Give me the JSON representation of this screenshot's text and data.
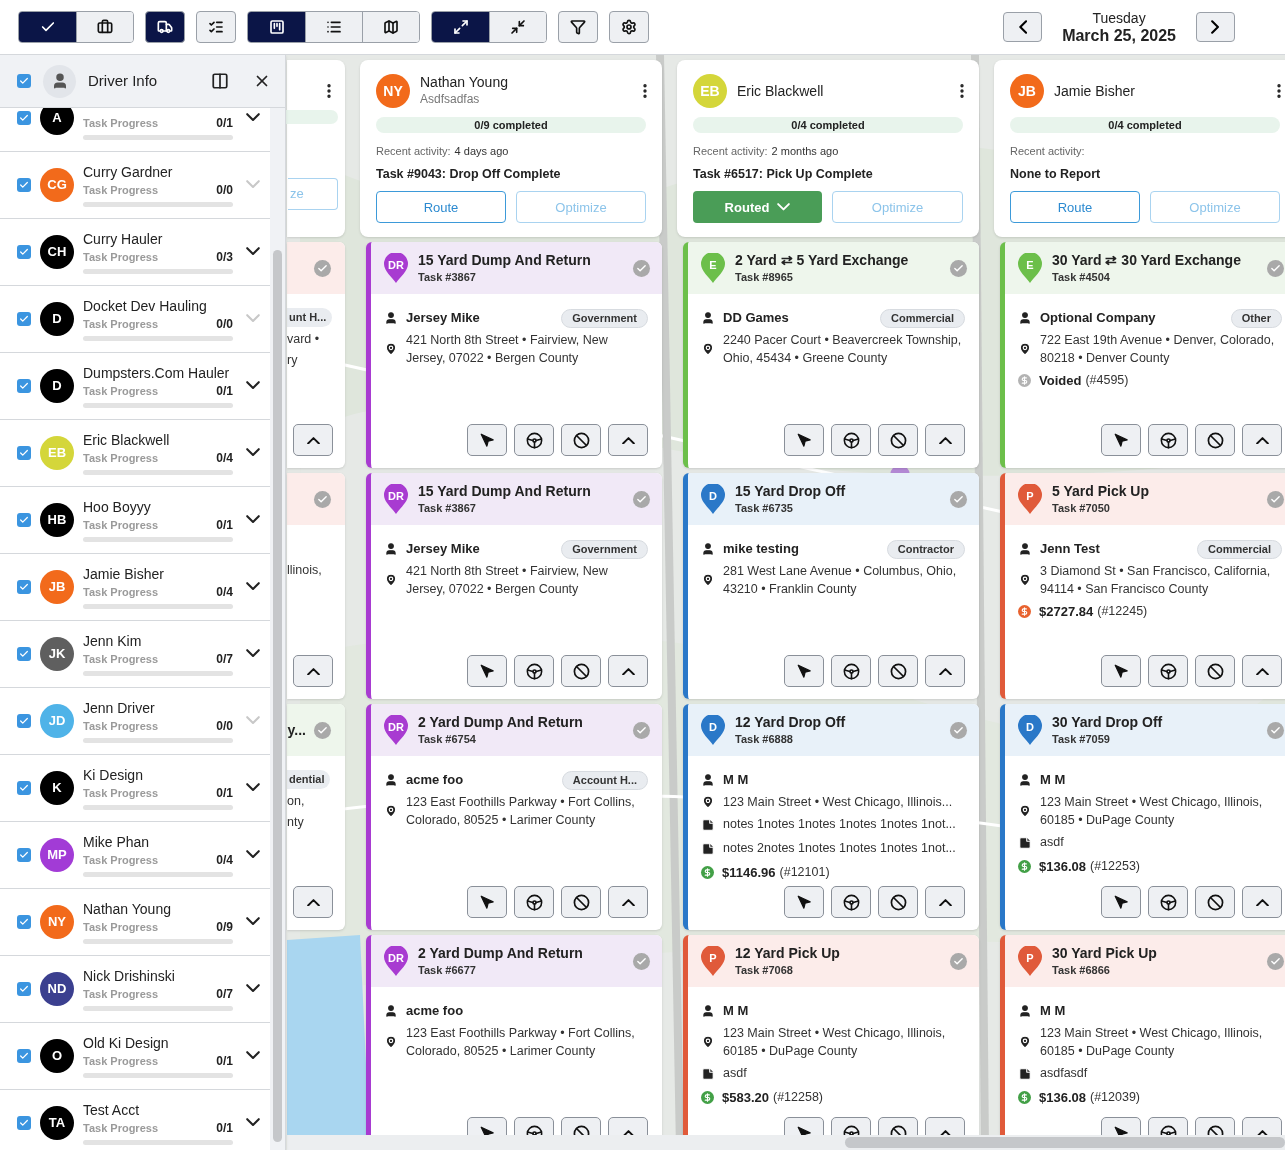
{
  "toolbar": {
    "groups": [
      {
        "buttons": [
          {
            "kind": "check",
            "selected": true
          },
          {
            "kind": "briefcase",
            "selected": false
          }
        ]
      },
      {
        "buttons": [
          {
            "kind": "truck",
            "selected": true
          }
        ]
      },
      {
        "buttons": [
          {
            "kind": "checklist",
            "selected": false
          }
        ]
      },
      {
        "buttons": [
          {
            "kind": "board",
            "selected": true
          },
          {
            "kind": "list",
            "selected": false
          },
          {
            "kind": "map",
            "selected": false
          }
        ]
      },
      {
        "buttons": [
          {
            "kind": "expand",
            "selected": true
          },
          {
            "kind": "collapse",
            "selected": false
          }
        ]
      },
      {
        "buttons": [
          {
            "kind": "filter",
            "selected": false
          }
        ]
      },
      {
        "buttons": [
          {
            "kind": "settings",
            "selected": false
          }
        ]
      }
    ]
  },
  "date_nav": {
    "weekday": "Tuesday",
    "date": "March 25, 2025"
  },
  "sidebar": {
    "title": "Driver Info",
    "checked": true,
    "drivers": [
      {
        "initials": "A",
        "color": "#000000",
        "checked": true,
        "label": "Task Progress",
        "count": "0/1",
        "level": 0,
        "disabled": false
      },
      {
        "initials": "CG",
        "name": "Curry Gardner",
        "color": "#f26a1b",
        "checked": true,
        "label": "Task Progress",
        "count": "0/0",
        "level": 0,
        "disabled": true
      },
      {
        "initials": "CH",
        "name": "Curry Hauler",
        "color": "#000000",
        "checked": true,
        "label": "Task Progress",
        "count": "0/3",
        "level": 0,
        "disabled": false
      },
      {
        "initials": "D",
        "name": "Docket Dev Hauling",
        "color": "#000000",
        "checked": true,
        "label": "Task Progress",
        "count": "0/0",
        "level": 0,
        "disabled": true
      },
      {
        "initials": "D",
        "name": "Dumpsters.Com Hauler",
        "color": "#000000",
        "checked": true,
        "label": "Task Progress",
        "count": "0/1",
        "level": 0,
        "disabled": false
      },
      {
        "initials": "EB",
        "name": "Eric Blackwell",
        "color": "#d4d63a",
        "checked": true,
        "label": "Task Progress",
        "count": "0/4",
        "level": 0,
        "disabled": false
      },
      {
        "initials": "HB",
        "name": "Hoo Boyyy",
        "color": "#000000",
        "checked": true,
        "label": "Task Progress",
        "count": "0/1",
        "level": 0,
        "disabled": false
      },
      {
        "initials": "JB",
        "name": "Jamie Bisher",
        "color": "#f26a1b",
        "checked": true,
        "label": "Task Progress",
        "count": "0/4",
        "level": 0,
        "disabled": false
      },
      {
        "initials": "JK",
        "name": "Jenn Kim",
        "color": "#5f5f5f",
        "checked": true,
        "label": "Task Progress",
        "count": "0/7",
        "level": 0,
        "disabled": false
      },
      {
        "initials": "JD",
        "name": "Jenn Driver",
        "color": "#4fb3e8",
        "checked": true,
        "label": "Task Progress",
        "count": "0/0",
        "level": 0,
        "disabled": true
      },
      {
        "initials": "K",
        "name": "Ki Design",
        "color": "#000000",
        "checked": true,
        "label": "Task Progress",
        "count": "0/1",
        "level": 0,
        "disabled": false
      },
      {
        "initials": "MP",
        "name": "Mike Phan",
        "color": "#a23bd6",
        "checked": true,
        "label": "Task Progress",
        "count": "0/4",
        "level": 0,
        "disabled": false
      },
      {
        "initials": "NY",
        "name": "Nathan Young",
        "color": "#f26a1b",
        "checked": true,
        "label": "Task Progress",
        "count": "0/9",
        "level": 0,
        "disabled": false
      },
      {
        "initials": "ND",
        "name": "Nick Drishinski",
        "color": "#3b3f8f",
        "checked": true,
        "label": "Task Progress",
        "count": "0/7",
        "level": 0,
        "disabled": false
      },
      {
        "initials": "O",
        "name": "Old Ki Design",
        "color": "#000000",
        "checked": true,
        "label": "Task Progress",
        "count": "0/1",
        "level": 0,
        "disabled": false
      },
      {
        "initials": "TA",
        "name": "Test Acct",
        "color": "#000000",
        "checked": true,
        "label": "Task Progress",
        "count": "0/1",
        "level": 0,
        "disabled": false
      }
    ]
  },
  "board": {
    "partial_column": {
      "optimize_fragment": "ze",
      "tasks": [
        {
          "kind": "pick_up",
          "chip": "unt H...",
          "lines": [
            "vard •",
            "ry"
          ]
        },
        {
          "kind": "pick_up",
          "lines": [
            "llinois,"
          ]
        },
        {
          "kind": "exchange",
          "title": "y...",
          "chip": "dential",
          "lines": [
            "on,",
            "nty"
          ]
        }
      ]
    },
    "columns": [
      {
        "driver": {
          "initials": "NY",
          "name": "Nathan Young",
          "subtitle": "Asdfsadfas",
          "color": "#f26a1b"
        },
        "completed": "0/9 completed",
        "level": 0,
        "activity_label": "Recent activity:",
        "activity_time": "4 days ago",
        "last_task": "Task #9043: Drop Off Complete",
        "route_button": {
          "label": "Route",
          "kind": "route"
        },
        "optimize_button": {
          "label": "Optimize",
          "disabled": true
        },
        "tasks": [
          {
            "kind": "dump_return",
            "marker": "DR",
            "title": "15 Yard Dump And Return",
            "number": "Task #3867",
            "customer": "Jersey Mike",
            "chip": "Government",
            "address": "421 North 8th Street • Fairview, New Jersey, 07022 • Bergen County"
          },
          {
            "kind": "dump_return",
            "marker": "DR",
            "title": "15 Yard Dump And Return",
            "number": "Task #3867",
            "customer": "Jersey Mike",
            "chip": "Government",
            "address": "421 North 8th Street • Fairview, New Jersey, 07022 • Bergen County"
          },
          {
            "kind": "dump_return",
            "marker": "DR",
            "title": "2 Yard Dump And Return",
            "number": "Task #6754",
            "customer": "acme foo",
            "chip": "Account H...",
            "address": "123 East Foothills Parkway • Fort Collins, Colorado, 80525 • Larimer County"
          },
          {
            "kind": "dump_return",
            "marker": "DR",
            "title": "2 Yard Dump And Return",
            "number": "Task #6677",
            "customer": "acme foo",
            "address": "123 East Foothills Parkway • Fort Collins, Colorado, 80525 • Larimer County"
          }
        ]
      },
      {
        "driver": {
          "initials": "EB",
          "name": "Eric Blackwell",
          "color": "#d4d63a"
        },
        "completed": "0/4 completed",
        "level": 0,
        "activity_label": "Recent activity:",
        "activity_time": "2 months ago",
        "last_task": "Task #6517: Pick Up Complete",
        "route_button": {
          "label": "Routed",
          "kind": "routed"
        },
        "optimize_button": {
          "label": "Optimize",
          "disabled": true
        },
        "tasks": [
          {
            "kind": "exchange",
            "marker": "E",
            "title": "2 Yard ⇄ 5 Yard Exchange",
            "number": "Task #8965",
            "customer": "DD Games",
            "chip": "Commercial",
            "address": "2240 Pacer Court • Beavercreek Township, Ohio, 45434 • Greene County"
          },
          {
            "kind": "drop_off",
            "marker": "D",
            "title": "15 Yard Drop Off",
            "number": "Task #6735",
            "customer": "mike testing",
            "chip": "Contractor",
            "address": "281 West Lane Avenue • Columbus, Ohio, 43210 • Franklin County"
          },
          {
            "kind": "drop_off",
            "marker": "D",
            "title": "12 Yard Drop Off",
            "number": "Task #6888",
            "customer": "M M",
            "address": "123 Main Street • West Chicago, Illinois...",
            "notes": [
              "notes 1notes 1notes 1notes 1notes 1not...",
              "notes 2notes 1notes 1notes 1notes 1not..."
            ],
            "payment": {
              "color": "#43a047",
              "amount": "$1146.96",
              "ref": "(#12101)"
            }
          },
          {
            "kind": "pick_up",
            "marker": "P",
            "title": "12 Yard Pick Up",
            "number": "Task #7068",
            "customer": "M M",
            "address": "123 Main Street • West Chicago, Illinois, 60185 • DuPage County",
            "notes": [
              "asdf"
            ],
            "payment": {
              "color": "#43a047",
              "amount": "$583.20",
              "ref": "(#12258)"
            }
          }
        ]
      },
      {
        "driver": {
          "initials": "JB",
          "name": "Jamie Bisher",
          "color": "#f26a1b"
        },
        "completed": "0/4 completed",
        "level": 0,
        "activity_label": "Recent activity:",
        "last_task": "None to Report",
        "route_button": {
          "label": "Route",
          "kind": "route"
        },
        "optimize_button": {
          "label": "Optimize",
          "disabled": true
        },
        "tasks": [
          {
            "kind": "exchange",
            "marker": "E",
            "title": "30 Yard ⇄ 30 Yard Exchange",
            "number": "Task #4504",
            "customer": "Optional Company",
            "chip": "Other",
            "address": "722 East 19th Avenue • Denver, Colorado, 80218 • Denver County",
            "payment": {
              "color": "#b3b3b3",
              "amount": "Voided",
              "ref": "(#4595)"
            }
          },
          {
            "kind": "pick_up",
            "marker": "P",
            "title": "5 Yard Pick Up",
            "number": "Task #7050",
            "customer": "Jenn Test",
            "chip": "Commercial",
            "address": "3 Diamond St • San Francisco, California, 94114 • San Francisco County",
            "payment": {
              "color": "#e8622e",
              "amount": "$2727.84",
              "ref": "(#12245)"
            }
          },
          {
            "kind": "drop_off",
            "marker": "D",
            "title": "30 Yard Drop Off",
            "number": "Task #7059",
            "customer": "M M",
            "address": "123 Main Street • West Chicago, Illinois, 60185 • DuPage County",
            "notes": [
              "asdf"
            ],
            "payment": {
              "color": "#43a047",
              "amount": "$136.08",
              "ref": "(#12253)"
            }
          },
          {
            "kind": "pick_up",
            "marker": "P",
            "title": "30 Yard Pick Up",
            "number": "Task #6866",
            "customer": "M M",
            "address": "123 Main Street • West Chicago, Illinois, 60185 • DuPage County",
            "notes": [
              "asdfasdf"
            ],
            "payment": {
              "color": "#43a047",
              "amount": "$136.08",
              "ref": "(#12039)"
            }
          }
        ]
      }
    ]
  }
}
